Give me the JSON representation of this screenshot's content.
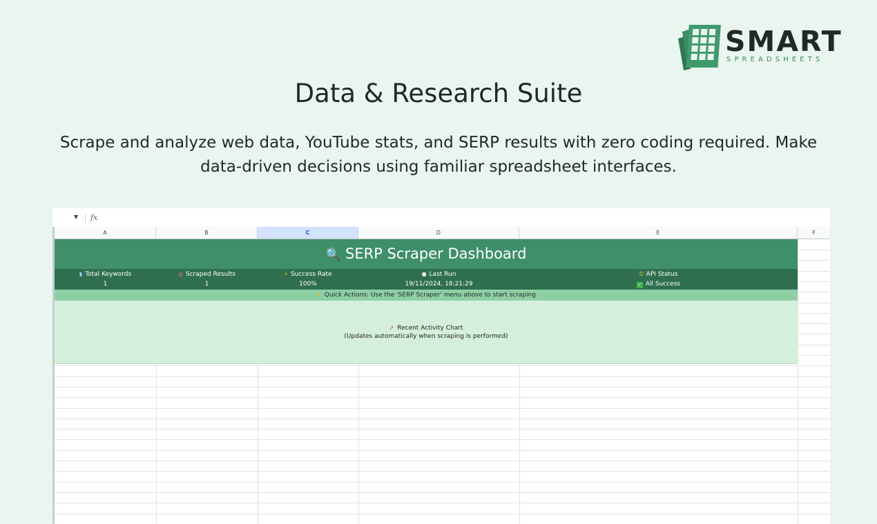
{
  "brand": {
    "name": "SMART",
    "tagline": "SPREADSHEETS",
    "colors": {
      "green": "#3f8f6b",
      "dark": "#1f2a24"
    }
  },
  "header": {
    "title": "Data & Research Suite",
    "subtitle": "Scrape and analyze web data, YouTube stats, and SERP results with zero coding required. Make data-driven decisions using familiar spreadsheet interfaces."
  },
  "sheet": {
    "formula_bar": {
      "fx_label": "fx"
    },
    "columns": [
      "A",
      "B",
      "C",
      "D",
      "E",
      "F"
    ],
    "selected_column": "C",
    "dashboard": {
      "title": "SERP Scraper Dashboard",
      "title_icon": "magnifier-icon",
      "stats": [
        {
          "icon": "bar-chart-icon",
          "icon_glyph": "▮",
          "label": "Total Keywords",
          "value": "1"
        },
        {
          "icon": "target-icon",
          "icon_glyph": "◎",
          "label": "Scraped Results",
          "value": "1"
        },
        {
          "icon": "lightning-icon",
          "icon_glyph": "⚡",
          "label": "Success Rate",
          "value": "100%"
        },
        {
          "icon": "clock-icon",
          "icon_glyph": "●",
          "label": "Last Run",
          "value": "19/11/2024, 18:21:29"
        },
        {
          "icon": "key-icon",
          "icon_glyph": "⚿",
          "label": "API Status",
          "value": "All Success",
          "value_icon": "check-icon"
        }
      ],
      "quick_actions": "Quick Actions: Use the 'SERP Scraper' menu above to start scraping",
      "chart_title": "Recent Activity Chart",
      "chart_note": "(Updates automatically when scraping is performed)"
    },
    "colors": {
      "banner": "#3f8f6b",
      "stats": "#2f6f50",
      "quick": "#8fcfa4",
      "chart": "#d4f0dc"
    }
  }
}
